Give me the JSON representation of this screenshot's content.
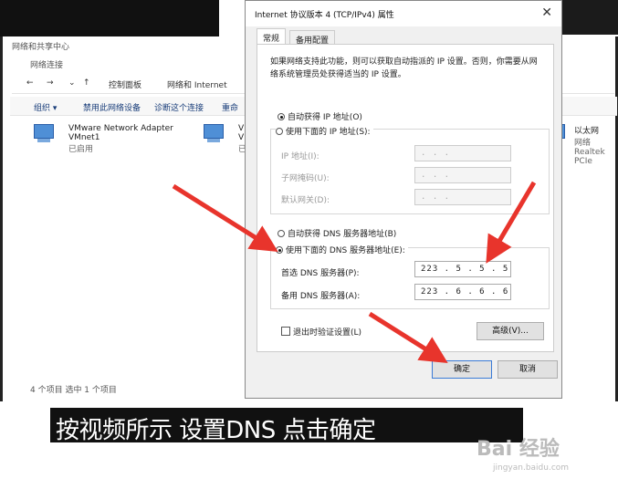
{
  "explorer": {
    "window_title": "网络和共享中心",
    "sub_title": "网络连接",
    "breadcrumb": [
      "控制面板",
      "网络和 Internet"
    ],
    "toolbar": [
      "组织 ▾",
      "禁用此网络设备",
      "诊断这个连接",
      "重命"
    ],
    "adapters": [
      {
        "name": "VMware Network Adapter",
        "line2": "VMnet1",
        "status": "已启用"
      },
      {
        "name": "V",
        "line2": "V",
        "status": "已"
      },
      {
        "name": "以太网",
        "line2": "网络",
        "status": "Realtek PCIe"
      }
    ],
    "status_bar": "4 个项目    选中 1 个项目"
  },
  "dialog": {
    "title": "Internet 协议版本 4 (TCP/IPv4) 属性",
    "close": "✕",
    "tabs": [
      "常规",
      "备用配置"
    ],
    "description": "如果网络支持此功能，则可以获取自动指派的 IP 设置。否则，你需要从网络系统管理员处获得适当的 IP 设置。",
    "ip_auto": "自动获得 IP 地址(O)",
    "ip_manual": "使用下面的 IP 地址(S):",
    "ip_fields": [
      {
        "label": "IP 地址(I):",
        "value": ".   .   ."
      },
      {
        "label": "子网掩码(U):",
        "value": ".   .   ."
      },
      {
        "label": "默认网关(D):",
        "value": ".   .   ."
      }
    ],
    "dns_auto": "自动获得 DNS 服务器地址(B)",
    "dns_manual": "使用下面的 DNS 服务器地址(E):",
    "dns_fields": [
      {
        "label": "首选 DNS 服务器(P):",
        "value": "223 .  5  .  5  .  5"
      },
      {
        "label": "备用 DNS 服务器(A):",
        "value": "223 .  6  .  6  .  6"
      }
    ],
    "validate": "退出时验证设置(L)",
    "advanced": "高级(V)...",
    "ok": "确定",
    "cancel": "取消",
    "bg_ok": "确定",
    "bg_cancel": "取消"
  },
  "caption": "按视频所示 设置DNS 点击确定",
  "watermark": "Bai 经验",
  "watermark_sub": "jingyan.baidu.com",
  "colors": {
    "arrow": "#e8342c",
    "caption_bg": "#111111",
    "accent": "#3b7bd6"
  }
}
